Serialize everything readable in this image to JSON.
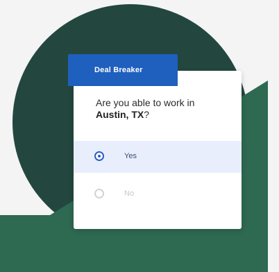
{
  "colors": {
    "page_background": "#f4f4f4",
    "circle_green": "#23473e",
    "shape_green": "#2e6952",
    "tag_blue": "#1f5fbe",
    "selected_background": "#e8eefc",
    "radio_blue": "#2d5ec7"
  },
  "card": {
    "tag_label": "Deal Breaker",
    "question_prefix": "Are you able to work in ",
    "question_location": "Austin, TX",
    "question_suffix": "?"
  },
  "options": [
    {
      "label": "Yes",
      "selected": true
    },
    {
      "label": "No",
      "selected": false
    }
  ]
}
